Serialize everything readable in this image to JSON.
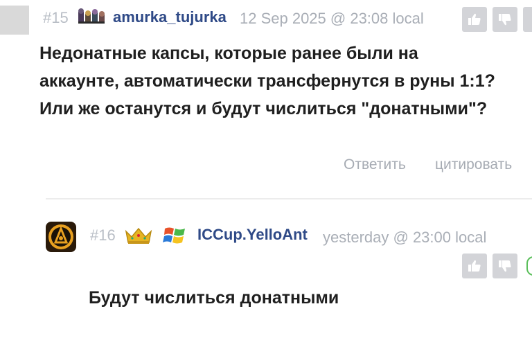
{
  "posts": [
    {
      "number": "#15",
      "username": "amurka_tujurka",
      "timestamp": "12 Sep 2025 @ 23:08 local",
      "body_lines": [
        "Недонатные капсы, которые ранее были на",
        "аккаунте, автоматически трансфернутся в руны 1:1?",
        "Или же останутся и будут числиться \"донатными\"?"
      ],
      "actions": {
        "reply": "Ответить",
        "quote": "цитировать"
      }
    },
    {
      "number": "#16",
      "username": "ICCup.YelloAnt",
      "timestamp": "yesterday @ 23:00 local",
      "body_lines": [
        "Будут числиться донатными"
      ]
    }
  ],
  "icons": {
    "like": "thumbs-up-icon",
    "dislike": "thumbs-down-icon",
    "badge_15": "team-badge-icon",
    "crown": "crown-icon",
    "windows": "windows-logo-icon",
    "avatar_16": "biohazard-avatar-icon"
  },
  "colors": {
    "username": "#2f4a87",
    "muted": "#a9aeb6",
    "vote_bg": "#d3d4d8",
    "crown": "#e6b422",
    "accent_green": "#5bbf5b"
  }
}
